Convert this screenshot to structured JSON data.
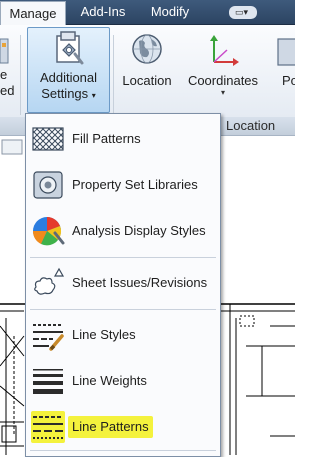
{
  "tabs": [
    {
      "label": "Manage",
      "active": true
    },
    {
      "label": "Add-Ins",
      "active": false
    },
    {
      "label": "Modify",
      "active": false
    }
  ],
  "tab_menu_glyph": "▭▾",
  "ribbon": {
    "left_partial": [
      "e",
      "ed"
    ],
    "additional_settings": {
      "line1": "Additional",
      "line2": "Settings",
      "caret": "▾"
    },
    "location": {
      "label": "Location"
    },
    "coordinates": {
      "label": "Coordinates",
      "caret": "▾"
    },
    "right_partial": "Po",
    "panel_title": "Location"
  },
  "menu": {
    "items": [
      {
        "label": "Fill Patterns",
        "icon": "fill-patterns-icon"
      },
      {
        "label": "Property Set Libraries",
        "icon": "property-set-libraries-icon"
      },
      {
        "label": "Analysis Display Styles",
        "icon": "analysis-display-styles-icon"
      },
      {
        "label": "Sheet Issues/Revisions",
        "icon": "sheet-issues-revisions-icon"
      },
      {
        "label": "Line Styles",
        "icon": "line-styles-icon"
      },
      {
        "label": "Line Weights",
        "icon": "line-weights-icon"
      },
      {
        "label": "Line Patterns",
        "icon": "line-patterns-icon",
        "highlighted": true
      }
    ]
  },
  "colors": {
    "tabbar": "#2c4462",
    "highlight": "#f4f23d",
    "selected_button": "#b6d6f2"
  }
}
